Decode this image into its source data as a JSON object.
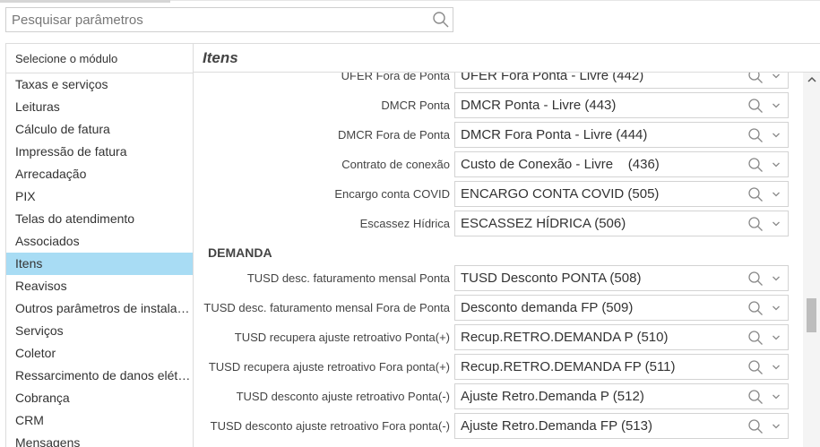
{
  "search": {
    "placeholder": "Pesquisar parâmetros",
    "icon": "search-icon"
  },
  "sidebar": {
    "header": "Selecione o módulo",
    "items": [
      {
        "label": "Taxas e serviços"
      },
      {
        "label": "Leituras"
      },
      {
        "label": "Cálculo de fatura"
      },
      {
        "label": "Impressão de fatura"
      },
      {
        "label": "Arrecadação"
      },
      {
        "label": "PIX"
      },
      {
        "label": "Telas do atendimento"
      },
      {
        "label": "Associados"
      },
      {
        "label": "Itens",
        "active": true
      },
      {
        "label": "Reavisos"
      },
      {
        "label": "Outros parâmetros de instalação"
      },
      {
        "label": "Serviços"
      },
      {
        "label": "Coletor"
      },
      {
        "label": "Ressarcimento de danos elétricos"
      },
      {
        "label": "Cobrança"
      },
      {
        "label": "CRM"
      },
      {
        "label": "Mensagens"
      }
    ],
    "active_color": "#a8dcf4"
  },
  "main": {
    "title": "Itens",
    "fields_top": [
      {
        "label": "UFER Fora de Ponta",
        "value": "UFER Fora Ponta - Livre (442)"
      },
      {
        "label": "DMCR Ponta",
        "value": "DMCR Ponta - Livre (443)"
      },
      {
        "label": "DMCR Fora de Ponta",
        "value": "DMCR Fora Ponta - Livre (444)"
      },
      {
        "label": "Contrato de conexão",
        "value": "Custo de Conexão - Livre    (436)"
      },
      {
        "label": "Encargo conta COVID",
        "value": "ENCARGO CONTA COVID (505)"
      },
      {
        "label": "Escassez Hídrica",
        "value": "ESCASSEZ HÍDRICA (506)"
      }
    ],
    "section_demanda": "DEMANDA",
    "fields_demanda": [
      {
        "label": "TUSD desc. faturamento mensal Ponta",
        "value": "TUSD Desconto PONTA (508)"
      },
      {
        "label": "TUSD desc. faturamento mensal Fora de Ponta",
        "value": "Desconto demanda FP (509)"
      },
      {
        "label": "TUSD recupera ajuste retroativo Ponta(+)",
        "value": "Recup.RETRO.DEMANDA P (510)"
      },
      {
        "label": "TUSD recupera ajuste retroativo Fora ponta(+)",
        "value": "Recup.RETRO.DEMANDA FP (511)"
      },
      {
        "label": "TUSD desconto ajuste retroativo Ponta(-)",
        "value": "Ajuste Retro.Demanda P (512)"
      },
      {
        "label": "TUSD desconto ajuste retroativo Fora ponta(-)",
        "value": "Ajuste Retro.Demanda FP (513)"
      }
    ]
  }
}
